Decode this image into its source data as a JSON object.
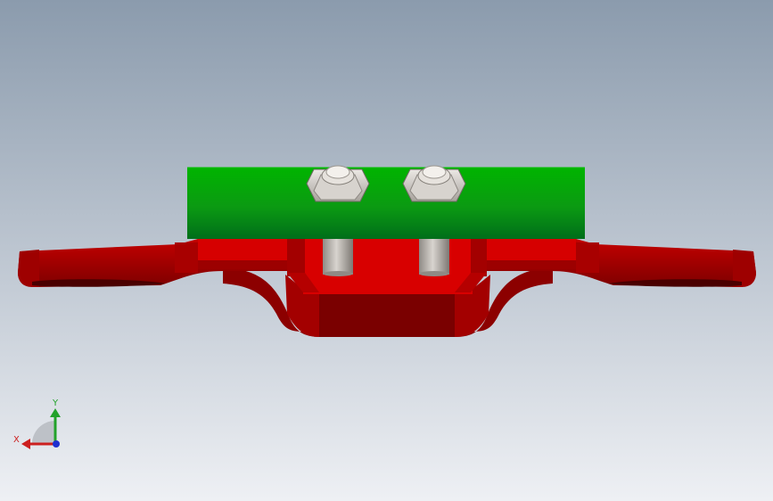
{
  "viewport": {
    "background_top": "#8b9bad",
    "background_bottom": "#eef0f4"
  },
  "model": {
    "bracket_color": "#c40000",
    "bracket_shadow": "#7a0000",
    "block_color": "#00b400",
    "block_shadow": "#006e1a",
    "fastener_color": "#c9c4be"
  },
  "triad": {
    "x_label": "X",
    "y_label": "Y",
    "x_color": "#cc1f1f",
    "y_color": "#22a22a",
    "z_color": "#1f2fd0"
  }
}
